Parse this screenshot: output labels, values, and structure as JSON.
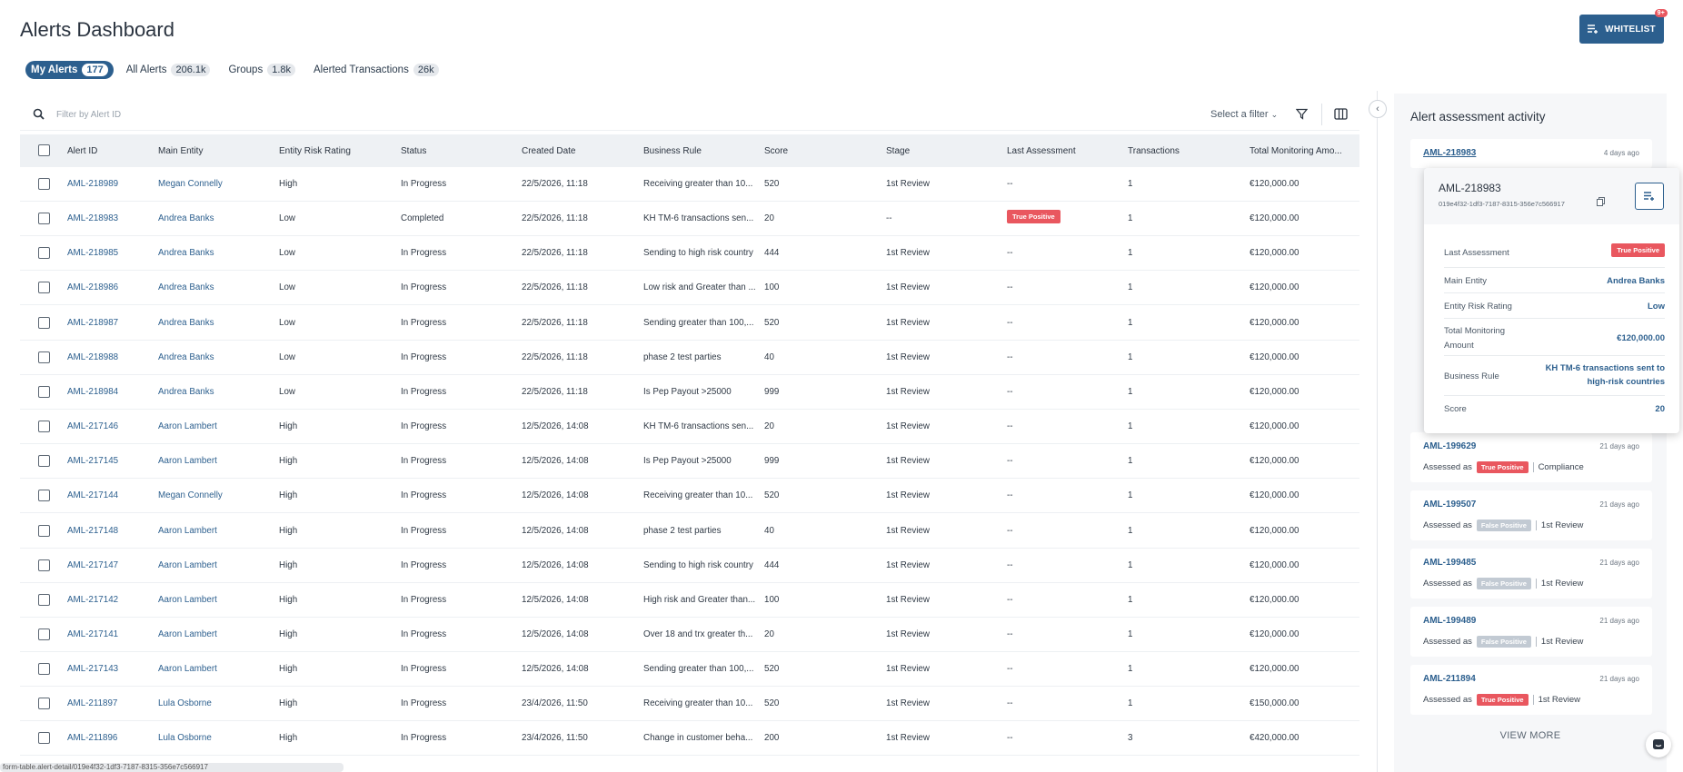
{
  "header": {
    "title": "Alerts Dashboard",
    "whitelist_label": "WHITELIST",
    "whitelist_badge": "9+"
  },
  "tabs": [
    {
      "label": "My Alerts",
      "count": "177"
    },
    {
      "label": "All Alerts",
      "count": "206.1k"
    },
    {
      "label": "Groups",
      "count": "1.8k"
    },
    {
      "label": "Alerted Transactions",
      "count": "26k"
    }
  ],
  "filter": {
    "placeholder": "Filter by Alert ID",
    "select_label": "Select a filter"
  },
  "columns": [
    "Alert ID",
    "Main Entity",
    "Entity Risk Rating",
    "Status",
    "Created Date",
    "Business Rule",
    "Score",
    "Stage",
    "Last Assessment",
    "Transactions",
    "Total Monitoring Amo..."
  ],
  "rows": [
    [
      "AML-218989",
      "Megan Connelly",
      "High",
      "In Progress",
      "22/5/2026, 11:18",
      "Receiving greater than 10...",
      "520",
      "1st Review",
      "--",
      "1",
      "€120,000.00"
    ],
    [
      "AML-218983",
      "Andrea Banks",
      "Low",
      "Completed",
      "22/5/2026, 11:18",
      "KH TM-6 transactions sen...",
      "20",
      "--",
      "True Positive",
      "1",
      "€120,000.00"
    ],
    [
      "AML-218985",
      "Andrea Banks",
      "Low",
      "In Progress",
      "22/5/2026, 11:18",
      "Sending to high risk country",
      "444",
      "1st Review",
      "--",
      "1",
      "€120,000.00"
    ],
    [
      "AML-218986",
      "Andrea Banks",
      "Low",
      "In Progress",
      "22/5/2026, 11:18",
      "Low risk and Greater than ...",
      "100",
      "1st Review",
      "--",
      "1",
      "€120,000.00"
    ],
    [
      "AML-218987",
      "Andrea Banks",
      "Low",
      "In Progress",
      "22/5/2026, 11:18",
      "Sending greater than 100,...",
      "520",
      "1st Review",
      "--",
      "1",
      "€120,000.00"
    ],
    [
      "AML-218988",
      "Andrea Banks",
      "Low",
      "In Progress",
      "22/5/2026, 11:18",
      "phase 2 test parties",
      "40",
      "1st Review",
      "--",
      "1",
      "€120,000.00"
    ],
    [
      "AML-218984",
      "Andrea Banks",
      "Low",
      "In Progress",
      "22/5/2026, 11:18",
      "Is Pep Payout >25000",
      "999",
      "1st Review",
      "--",
      "1",
      "€120,000.00"
    ],
    [
      "AML-217146",
      "Aaron Lambert",
      "High",
      "In Progress",
      "12/5/2026, 14:08",
      "KH TM-6 transactions sen...",
      "20",
      "1st Review",
      "--",
      "1",
      "€120,000.00"
    ],
    [
      "AML-217145",
      "Aaron Lambert",
      "High",
      "In Progress",
      "12/5/2026, 14:08",
      "Is Pep Payout >25000",
      "999",
      "1st Review",
      "--",
      "1",
      "€120,000.00"
    ],
    [
      "AML-217144",
      "Megan Connelly",
      "High",
      "In Progress",
      "12/5/2026, 14:08",
      "Receiving greater than 10...",
      "520",
      "1st Review",
      "--",
      "1",
      "€120,000.00"
    ],
    [
      "AML-217148",
      "Aaron Lambert",
      "High",
      "In Progress",
      "12/5/2026, 14:08",
      "phase 2 test parties",
      "40",
      "1st Review",
      "--",
      "1",
      "€120,000.00"
    ],
    [
      "AML-217147",
      "Aaron Lambert",
      "High",
      "In Progress",
      "12/5/2026, 14:08",
      "Sending to high risk country",
      "444",
      "1st Review",
      "--",
      "1",
      "€120,000.00"
    ],
    [
      "AML-217142",
      "Aaron Lambert",
      "High",
      "In Progress",
      "12/5/2026, 14:08",
      "High risk and Greater than...",
      "100",
      "1st Review",
      "--",
      "1",
      "€120,000.00"
    ],
    [
      "AML-217141",
      "Aaron Lambert",
      "High",
      "In Progress",
      "12/5/2026, 14:08",
      "Over 18 and trx greater th...",
      "20",
      "1st Review",
      "--",
      "1",
      "€120,000.00"
    ],
    [
      "AML-217143",
      "Aaron Lambert",
      "High",
      "In Progress",
      "12/5/2026, 14:08",
      "Sending greater than 100,...",
      "520",
      "1st Review",
      "--",
      "1",
      "€120,000.00"
    ],
    [
      "AML-211897",
      "Lula Osborne",
      "High",
      "In Progress",
      "23/4/2026, 11:50",
      "Receiving greater than 10...",
      "520",
      "1st Review",
      "--",
      "1",
      "€150,000.00"
    ],
    [
      "AML-211896",
      "Lula Osborne",
      "High",
      "In Progress",
      "23/4/2026, 11:50",
      "Change in customer beha...",
      "200",
      "1st Review",
      "--",
      "3",
      "€420,000.00"
    ]
  ],
  "scroll_hint": "form-table.alert-detail/019e4f32-1df3-7187-8315-356e7c566917",
  "panel": {
    "title": "Alert assessment activity",
    "top_card": {
      "id": "AML-218983",
      "ago": "4 days ago"
    },
    "cards": [
      {
        "id": "AML-199629",
        "ago": "21 days ago",
        "assessed_as": "Assessed as",
        "tag": "True Positive",
        "tag_kind": "tp",
        "stage": "Compliance"
      },
      {
        "id": "AML-199507",
        "ago": "21 days ago",
        "assessed_as": "Assessed as",
        "tag": "False Positive",
        "tag_kind": "fp",
        "stage": "1st Review"
      },
      {
        "id": "AML-199485",
        "ago": "21 days ago",
        "assessed_as": "Assessed as",
        "tag": "False Positive",
        "tag_kind": "fp",
        "stage": "1st Review"
      },
      {
        "id": "AML-199489",
        "ago": "21 days ago",
        "assessed_as": "Assessed as",
        "tag": "False Positive",
        "tag_kind": "fp",
        "stage": "1st Review"
      },
      {
        "id": "AML-211894",
        "ago": "21 days ago",
        "assessed_as": "Assessed as",
        "tag": "True Positive",
        "tag_kind": "tp",
        "stage": "1st Review"
      }
    ],
    "view_more": "VIEW MORE"
  },
  "popup": {
    "id": "AML-218983",
    "uuid": "019e4f32-1df3-7187-8315-356e7c566917",
    "last_assessment_label": "Last Assessment",
    "last_assessment_value": "True Positive",
    "main_entity_label": "Main Entity",
    "main_entity_value": "Andrea Banks",
    "risk_label": "Entity Risk Rating",
    "risk_value": "Low",
    "amount_label_1": "Total Monitoring",
    "amount_label_2": "Amount",
    "amount_value": "€120,000.00",
    "rule_label": "Business Rule",
    "rule_value_1": "KH TM-6 transactions sent to",
    "rule_value_2": "high-risk countries",
    "score_label": "Score",
    "score_value": "20"
  },
  "colors": {
    "primary": "#2c5f8e",
    "true_positive": "#e9575f",
    "false_positive": "#c2cad3"
  }
}
